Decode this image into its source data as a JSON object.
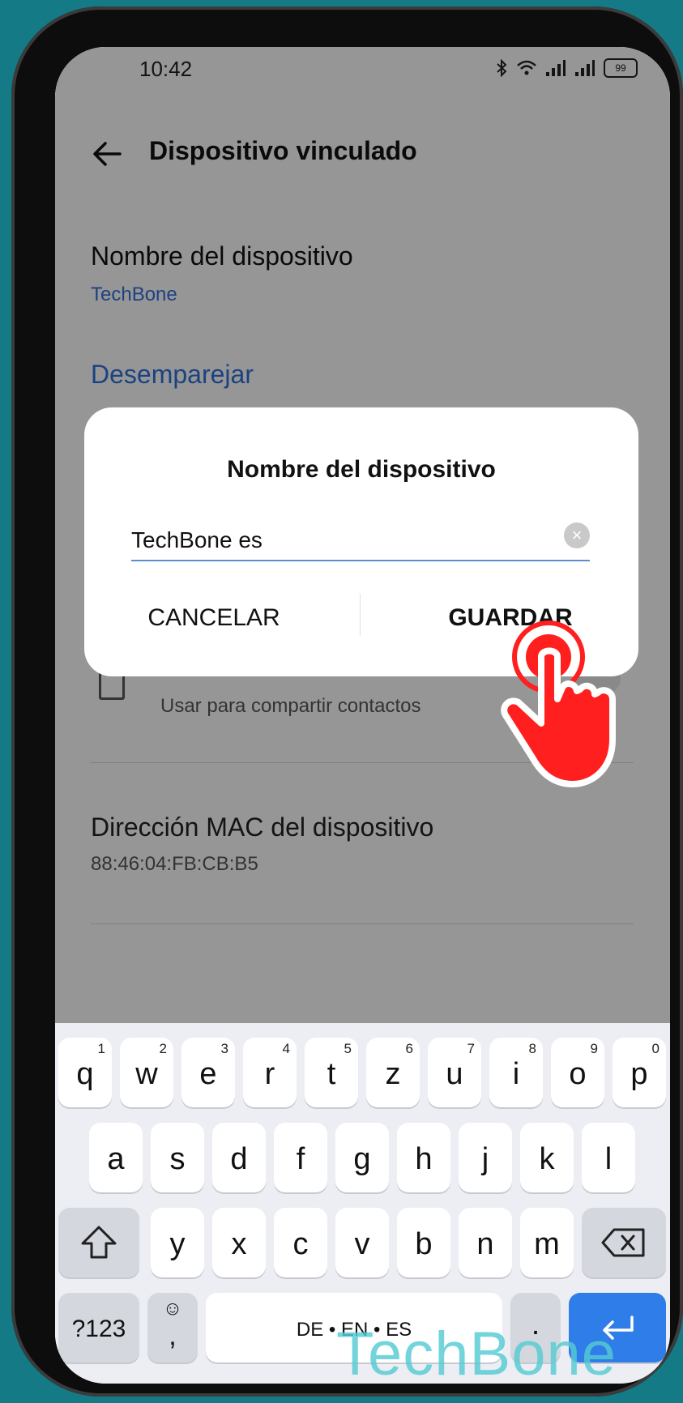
{
  "status_bar": {
    "time": "10:42",
    "battery": "99"
  },
  "app_bar": {
    "title": "Dispositivo vinculado"
  },
  "settings": {
    "device_name_label": "Nombre del dispositivo",
    "device_name_value": "TechBone",
    "unpair_label": "Desemparejar",
    "contacts_sub": "Usar para compartir contactos",
    "mac_label": "Dirección MAC del dispositivo",
    "mac_value": "88:46:04:FB:CB:B5"
  },
  "dialog": {
    "title": "Nombre del dispositivo",
    "input_value": "TechBone es",
    "cancel_label": "CANCELAR",
    "save_label": "GUARDAR"
  },
  "keyboard": {
    "row1": [
      {
        "char": "q",
        "num": "1"
      },
      {
        "char": "w",
        "num": "2"
      },
      {
        "char": "e",
        "num": "3"
      },
      {
        "char": "r",
        "num": "4"
      },
      {
        "char": "t",
        "num": "5"
      },
      {
        "char": "z",
        "num": "6"
      },
      {
        "char": "u",
        "num": "7"
      },
      {
        "char": "i",
        "num": "8"
      },
      {
        "char": "o",
        "num": "9"
      },
      {
        "char": "p",
        "num": "0"
      }
    ],
    "row2": [
      "a",
      "s",
      "d",
      "f",
      "g",
      "h",
      "j",
      "k",
      "l"
    ],
    "row3": [
      "y",
      "x",
      "c",
      "v",
      "b",
      "n",
      "m"
    ],
    "symbols_label": "?123",
    "comma_label": ",",
    "space_label": "DE • EN • ES",
    "period_label": "."
  },
  "watermark": "TechBone"
}
